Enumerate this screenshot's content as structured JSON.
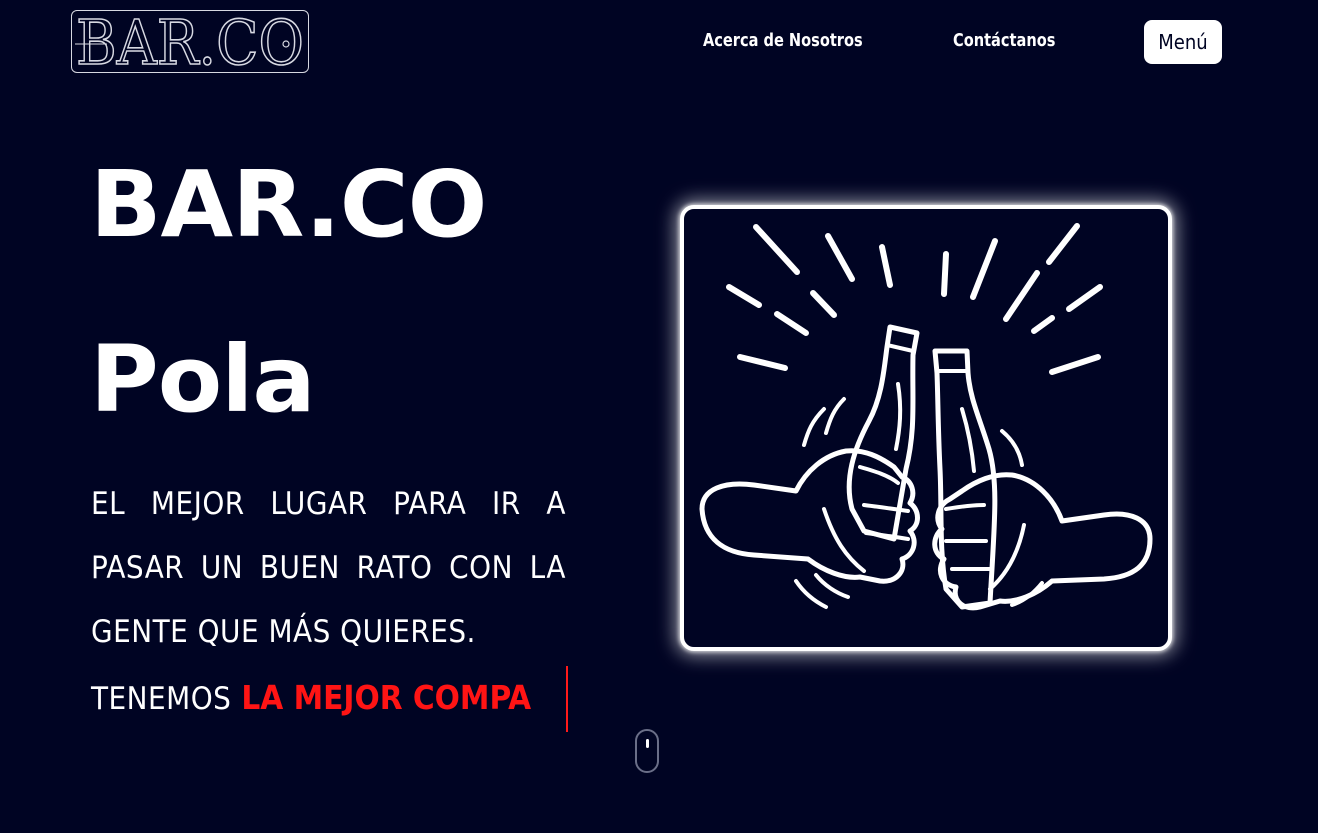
{
  "header": {
    "logo_text": "BAR.CO",
    "nav": {
      "about": "Acerca de Nosotros",
      "contact": "Contáctanos"
    },
    "menu_label": "Menú"
  },
  "hero": {
    "title_line1": "BAR.CO",
    "title_line2": "Pola",
    "description": "El mejor lugar para ir a pasar un buen rato con la gente que más quieres.",
    "tagline_prefix": "TENEMOS",
    "tagline_typed": "LA MEJOR COMPA"
  },
  "image": {
    "icon": "bottles-toast-icon"
  },
  "scroll": {
    "icon": "mouse-scroll-icon"
  },
  "colors": {
    "background": "#000423",
    "accent": "#ff1414",
    "text": "#ffffff",
    "menu_button_text": "#000423"
  }
}
